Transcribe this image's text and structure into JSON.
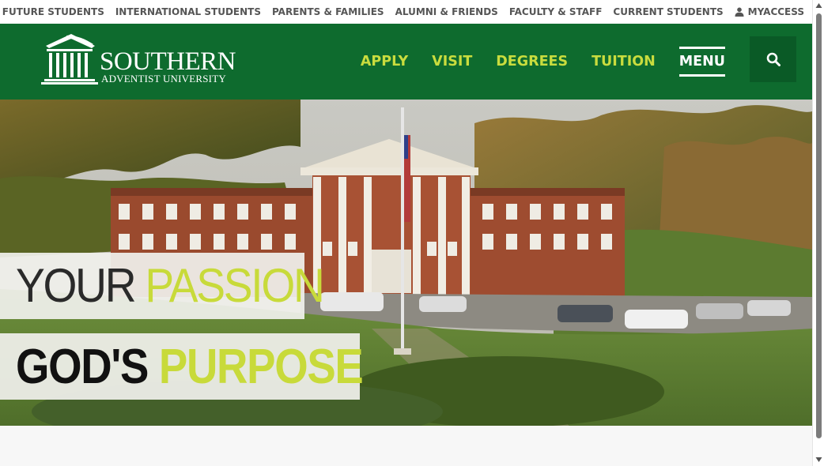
{
  "utility_nav": {
    "items": [
      {
        "label": "FUTURE STUDENTS"
      },
      {
        "label": "INTERNATIONAL STUDENTS"
      },
      {
        "label": "PARENTS & FAMILIES"
      },
      {
        "label": "ALUMNI & FRIENDS"
      },
      {
        "label": "FACULTY & STAFF"
      },
      {
        "label": "CURRENT STUDENTS"
      }
    ],
    "myaccess": {
      "label": "MYACCESS",
      "icon": "user-icon"
    }
  },
  "header": {
    "logo": {
      "word": "SOUTHERN",
      "sub": "ADVENTIST UNIVERSITY",
      "icon": "columns-building-icon"
    },
    "nav": [
      {
        "label": "APPLY"
      },
      {
        "label": "VISIT"
      },
      {
        "label": "DEGREES"
      },
      {
        "label": "TUITION"
      }
    ],
    "menu_label": "MENU",
    "search_icon": "search-icon"
  },
  "hero": {
    "line1": {
      "part1": "YOUR",
      "part2": "PASSION"
    },
    "line2": {
      "part1": "GOD'S",
      "part2": "PURPOSE"
    }
  },
  "colors": {
    "brand_green": "#0e6b2e",
    "accent_lime": "#c9dc3e",
    "utility_text": "#555555"
  }
}
